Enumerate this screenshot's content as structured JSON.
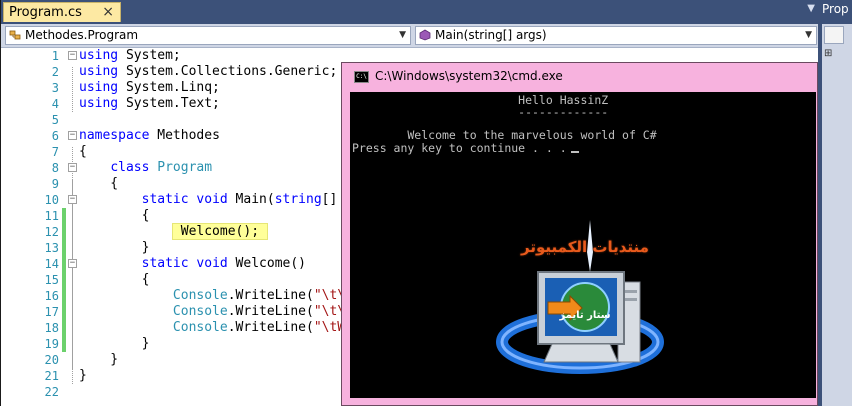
{
  "editor": {
    "tab_label": "Program.cs",
    "tab_close": "×",
    "type_dropdown": "Methodes.Program",
    "member_dropdown": "Main(string[] args)",
    "lines": [
      {
        "n": "1",
        "code": "using System;"
      },
      {
        "n": "2",
        "code": "using System.Collections.Generic;"
      },
      {
        "n": "3",
        "code": "using System.Linq;"
      },
      {
        "n": "4",
        "code": "using System.Text;"
      },
      {
        "n": "5",
        "code": ""
      },
      {
        "n": "6",
        "code": "namespace Methodes"
      },
      {
        "n": "7",
        "code": "{"
      },
      {
        "n": "8",
        "code": "    class Program"
      },
      {
        "n": "9",
        "code": "    {"
      },
      {
        "n": "10",
        "code": "        static void Main(string[] args"
      },
      {
        "n": "11",
        "code": "        {"
      },
      {
        "n": "12",
        "code": "            Welcome();"
      },
      {
        "n": "13",
        "code": "        }"
      },
      {
        "n": "14",
        "code": "        static void Welcome()"
      },
      {
        "n": "15",
        "code": "        {"
      },
      {
        "n": "16",
        "code": "            Console.WriteLine(\"\\t\\t\\tH"
      },
      {
        "n": "17",
        "code": "            Console.WriteLine(\"\\t\\t\\t-"
      },
      {
        "n": "18",
        "code": "            Console.WriteLine(\"\\tWelco"
      },
      {
        "n": "19",
        "code": "        }"
      },
      {
        "n": "20",
        "code": "    }"
      },
      {
        "n": "21",
        "code": "}"
      },
      {
        "n": "22",
        "code": ""
      }
    ]
  },
  "right_panel": {
    "tab_label": "Prop"
  },
  "cmd": {
    "title": "C:\\Windows\\system32\\cmd.exe",
    "icon_text": "C:\\",
    "console_lines": [
      "                        Hello HassinZ",
      "                        -------------",
      "",
      "        Welcome to the marvelous world of C#",
      "Press any key to continue . . ."
    ],
    "logo_text_top": "منتديات الكمبيوتر",
    "logo_text_screen": "ستار تايمز"
  },
  "colors": {
    "keyword": "#0000ff",
    "type": "#2b91af",
    "string": "#a31515",
    "line_number": "#2b91af",
    "change_bar": "#6cd16c",
    "highlight": "#ffff99",
    "tab_bg": "#fde9a3",
    "ide_chrome": "#3c5179",
    "cmd_frame": "#f7b2de",
    "console_bg": "#000000",
    "console_text": "#c0c0c0"
  }
}
